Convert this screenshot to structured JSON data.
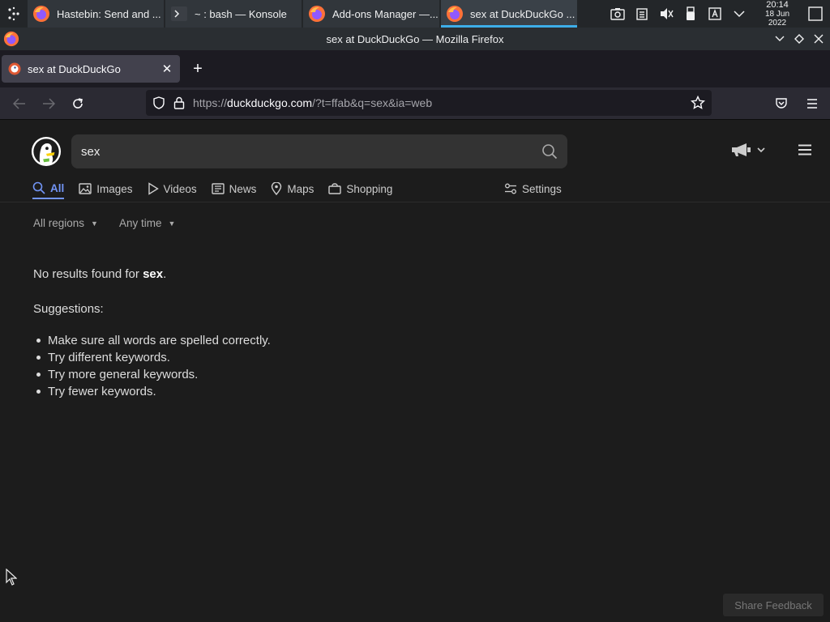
{
  "taskbar": {
    "tasks": [
      {
        "label": "Hastebin: Send and ...",
        "icon": "firefox-icon"
      },
      {
        "label": "~ : bash — Konsole",
        "icon": "terminal-icon"
      },
      {
        "label": "Add-ons Manager —...",
        "icon": "firefox-icon"
      },
      {
        "label": "sex at DuckDuckGo ...",
        "icon": "firefox-icon",
        "active": true
      }
    ],
    "clock": {
      "time": "20:14",
      "date": "18 Jun 2022"
    }
  },
  "window": {
    "title": "sex at DuckDuckGo — Mozilla Firefox"
  },
  "browser": {
    "tab": {
      "title": "sex at DuckDuckGo"
    },
    "new_tab_label": "+",
    "url": {
      "scheme": "https://",
      "host": "duckduckgo.com",
      "path": "/?t=ffab&q=sex&ia=web"
    }
  },
  "ddg": {
    "query": "sex",
    "tabs": [
      {
        "label": "All",
        "icon": "search-icon"
      },
      {
        "label": "Images",
        "icon": "image-icon"
      },
      {
        "label": "Videos",
        "icon": "play-icon"
      },
      {
        "label": "News",
        "icon": "newspaper-icon"
      },
      {
        "label": "Maps",
        "icon": "map-pin-icon"
      },
      {
        "label": "Shopping",
        "icon": "shopping-bag-icon"
      }
    ],
    "settings_label": "Settings",
    "filters": {
      "region": "All regions",
      "time": "Any time"
    },
    "no_results": {
      "prefix": "No results found for ",
      "query": "sex",
      "suffix": "."
    },
    "suggestions_title": "Suggestions:",
    "suggestions": [
      "Make sure all words are spelled correctly.",
      "Try different keywords.",
      "Try more general keywords.",
      "Try fewer keywords."
    ],
    "feedback_label": "Share Feedback"
  },
  "colors": {
    "accent": "#7295f6",
    "taskbar_active": "#3daee9",
    "page_bg": "#1c1c1c"
  }
}
